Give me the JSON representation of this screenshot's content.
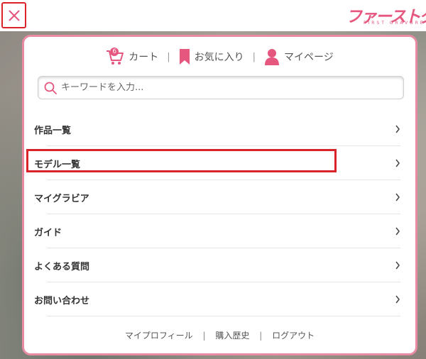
{
  "header": {
    "logo_text": "ファーストグラビア",
    "logo_subtext": "FIRST GRAVURE"
  },
  "account": {
    "cart_label": "カート",
    "cart_count": "6",
    "favorites_label": "お気に入り",
    "mypage_label": "マイページ",
    "separator": "|"
  },
  "search": {
    "placeholder": "キーワードを入力..."
  },
  "menu": {
    "items": [
      {
        "label": "作品一覧"
      },
      {
        "label": "モデル一覧"
      },
      {
        "label": "マイグラビア"
      },
      {
        "label": "ガイド"
      },
      {
        "label": "よくある質問"
      },
      {
        "label": "お問い合わせ"
      }
    ]
  },
  "footer": {
    "links": [
      {
        "label": "マイプロフィール"
      },
      {
        "label": "購入歴史"
      },
      {
        "label": "ログアウト"
      }
    ],
    "separator": "|"
  },
  "colors": {
    "accent_pink": "#e5577f",
    "panel_border": "#e88aa2",
    "highlight_red": "#d8232a"
  }
}
